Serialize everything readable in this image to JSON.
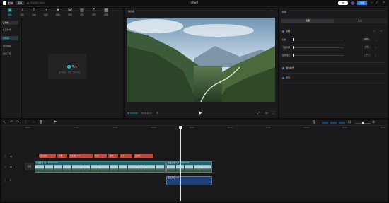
{
  "titlebar": {
    "logo": "剪映",
    "menu": "菜单",
    "autosave": "自动保存本地中",
    "title": "7月6日",
    "badge": "VIP",
    "export": "导出",
    "min": "–",
    "max": "□",
    "close": "×"
  },
  "toolbar": {
    "tabs": [
      {
        "icon": "▣",
        "label": "媒体"
      },
      {
        "icon": "♪",
        "label": "音频"
      },
      {
        "icon": "T",
        "label": "文本"
      },
      {
        "icon": "◔",
        "label": "贴纸"
      },
      {
        "icon": "✦",
        "label": "特效"
      },
      {
        "icon": "⋈",
        "label": "转场"
      },
      {
        "icon": "▤",
        "label": "滤镜"
      },
      {
        "icon": "⚙",
        "label": "调节"
      },
      {
        "icon": "▦",
        "label": "模板"
      }
    ]
  },
  "sidebar": {
    "items": [
      {
        "label": "▸ 本地"
      },
      {
        "label": "▸ 云素材"
      },
      {
        "label": "素材库"
      },
      {
        "label": "抖音收藏"
      },
      {
        "label": "链接下载"
      }
    ]
  },
  "media": {
    "import_plus": "+",
    "import_label": "导入",
    "import_sub": "支持视频、音频、图片素材"
  },
  "player": {
    "title": "播放器",
    "timecode_current": "00:00:00:00",
    "timecode_total": "00:00:40:13",
    "play": "▶"
  },
  "attr": {
    "title": "视频",
    "tabs": [
      "画面",
      "变速"
    ],
    "sections": {
      "basic": "基础",
      "blend": "混合模式",
      "anim": "背景"
    },
    "rows": [
      {
        "label": "缩放",
        "value": "100%"
      },
      {
        "label": "不透明度",
        "value": "100%"
      },
      {
        "label": "旋转角度",
        "value": "0°"
      }
    ],
    "reset": "重置"
  },
  "timeline": {
    "ruler": [
      "00:00",
      "00:10",
      "00:20",
      "00:30",
      "00:40",
      "00:50",
      "01:00",
      "01:10",
      "01:20",
      "01:30",
      "01:40",
      "01:50"
    ],
    "fx_labels": [
      "变速曲线",
      "闪黑",
      "色彩偏移 1.0",
      "抖动",
      "模糊",
      "放大",
      "变清晰"
    ],
    "cover": "封面",
    "clip1": "视频素材.mp4  00:00:21:23",
    "clip2": "视频素材.mp4  00:00:17:20",
    "audio_clip": "视频素材.mp4"
  },
  "colors": {
    "accent": "#26c6da",
    "export": "#2f7ee8",
    "fx": "#c04a3e",
    "video_track": "#1f5f66",
    "audio_track": "#1d3f73"
  }
}
